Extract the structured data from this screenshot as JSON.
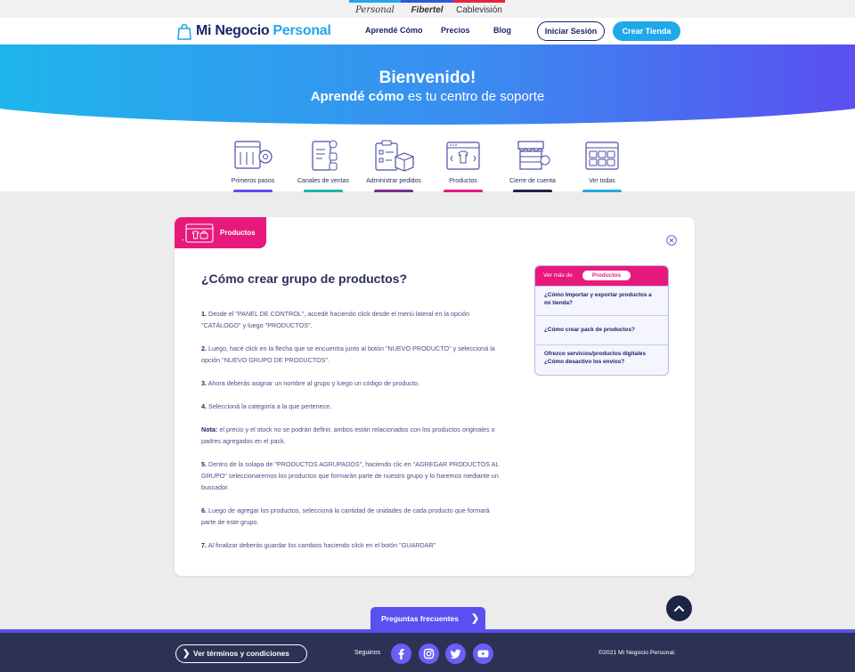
{
  "brands": {
    "personal": "Personal",
    "fibertel": "Fibertel",
    "cablevision": "Cablevisión"
  },
  "header": {
    "logo_part1": "Mi Negocio",
    "logo_part2": "Personal",
    "nav": [
      "Aprendé Cómo",
      "Precios",
      "Blog"
    ],
    "login_label": "Iniciar Sesión",
    "create_store_label": "Crear Tienda"
  },
  "hero": {
    "title": "Bienvenido!",
    "subtitle_bold": "Aprendé cómo",
    "subtitle_rest": " es tu centro de soporte"
  },
  "categories": [
    {
      "label": "Primeros pasos",
      "color": "#5a4ff0"
    },
    {
      "label": "Canales de ventas",
      "color": "#1fb3a3"
    },
    {
      "label": "Administrar pedidos",
      "color": "#7b2a8f"
    },
    {
      "label": "Productos",
      "color": "#e8197d"
    },
    {
      "label": "Cierre de cuenta",
      "color": "#1c2545"
    },
    {
      "label": "Ver todas",
      "color": "#1fa9e8"
    }
  ],
  "card": {
    "tag": "Productos",
    "title": "¿Cómo crear grupo de productos?",
    "steps": [
      {
        "num": "1.",
        "text": " Desde el \"PANEL DE CONTROL\", accedé haciendo click desde el menú lateral en la opción \"CATÁLOGO\" y luego \"PRODUCTOS\"."
      },
      {
        "num": "2.",
        "text": " Luego, hacé click en la flecha que se encuentra junto al botón \"NUEVO PRODUCTO\" y seleccioná la opción \"NUEVO GRUPO DE PRODUCTOS\"."
      },
      {
        "num": "3.",
        "text": " Ahora deberás asignar un nombre al grupo y luego un código de producto."
      },
      {
        "num": "4.",
        "text": " Seleccioná la categoría a la que pertenece."
      },
      {
        "num": "Nota:",
        "text": " el precio y el stock no se podrán definir, ambos están relacionados con los productos originales o padres agregados en el pack."
      },
      {
        "num": "5.",
        "text": " Dentro de la solapa de \"PRODUCTOS AGRUPADOS\", haciendo clic en \"AGREGAR PRODUCTOS AL GRUPO\" seleccionaremos los productos que formarán parte de nuestro grupo y lo haremos mediante un buscador."
      },
      {
        "num": "6.",
        "text": " Luego de agregar los productos, seleccioná la cantidad de unidades de cada producto que formará parte de este grupo."
      },
      {
        "num": "7.",
        "text": " Al finalizar deberás guardar los cambios haciendo click en el botón \"GUARDAR\""
      }
    ]
  },
  "related": {
    "label": "Ver más de",
    "pill": "Productos",
    "items": [
      "¿Cómo Importar y exportar productos a mi tienda?",
      "¿Cómo crear pack de productos?",
      "Ofrezco servicios/productos digitales ¿Cómo desactivo los envíos?"
    ]
  },
  "faq_label": "Preguntas frecuentes",
  "footer": {
    "terms_label": "Ver términos y condiciones",
    "follow_label": "Seguinos",
    "social": [
      "facebook-icon",
      "instagram-icon",
      "twitter-icon",
      "youtube-icon"
    ],
    "copyright": "©2021 Mi Negocio Personal."
  }
}
